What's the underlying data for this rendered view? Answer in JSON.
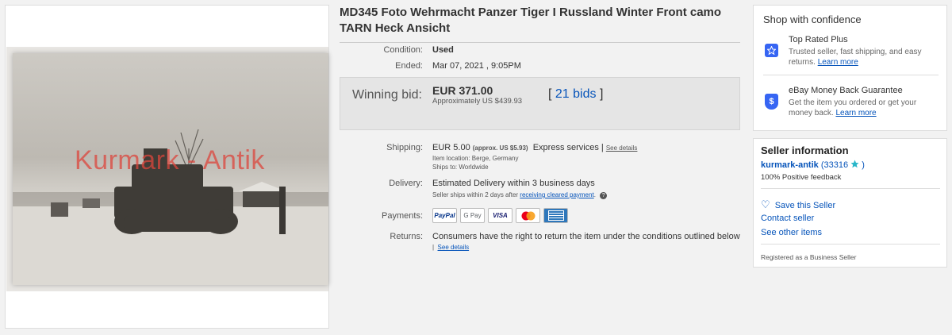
{
  "photo": {
    "watermark": "Kurmark - Antik"
  },
  "listing": {
    "title": "MD345 Foto Wehrmacht Panzer Tiger I Russland Winter Front camo TARN Heck Ansicht",
    "condition_label": "Condition:",
    "condition_value": "Used",
    "ended_label": "Ended:",
    "ended_value": "Mar 07, 2021 , 9:05PM",
    "winning_bid_label": "Winning bid:",
    "winning_bid_value": "EUR 371.00",
    "approx_label": "Approximately US $439.93",
    "bids_open": "[",
    "bids_link": "21 bids",
    "bids_close": "]",
    "shipping_label": "Shipping:",
    "shipping_value": "EUR 5.00",
    "shipping_approx": "(approx. US $5.93)",
    "shipping_service": "Express services |",
    "shipping_see_details": "See details",
    "item_location": "Item location:  Berge, Germany",
    "ships_to": "Ships to:  Worldwide",
    "delivery_label": "Delivery:",
    "delivery_value": "Estimated Delivery within 3 business days",
    "delivery_note": "Seller ships within 2 days after",
    "delivery_note_link": "receiving cleared payment",
    "delivery_note_end": ".",
    "payments_label": "Payments:",
    "payment_methods": [
      "PayPal",
      "G Pay",
      "VISA",
      "Mastercard",
      "AMEX"
    ],
    "returns_label": "Returns:",
    "returns_value": "Consumers have the right to return the item under the conditions outlined below",
    "returns_see_details": "See details"
  },
  "confidence": {
    "heading": "Shop with confidence",
    "top_rated_title": "Top Rated Plus",
    "top_rated_desc": "Trusted seller, fast shipping, and easy returns.",
    "top_rated_link": "Learn more",
    "mbg_title": "eBay Money Back Guarantee",
    "mbg_desc": "Get the item you ordered or get your money back.",
    "mbg_link": "Learn more"
  },
  "seller": {
    "heading": "Seller information",
    "name": "kurmark-antik",
    "feedback_open": "(33316",
    "feedback_close": ")",
    "positive": "100% Positive feedback",
    "save_seller": "Save this Seller",
    "contact": "Contact seller",
    "other_items": "See other items",
    "registered": "Registered as a Business Seller"
  },
  "colors": {
    "link": "#0654ba",
    "badge_blue": "#3665f3",
    "star_teal": "#29b6c9"
  }
}
